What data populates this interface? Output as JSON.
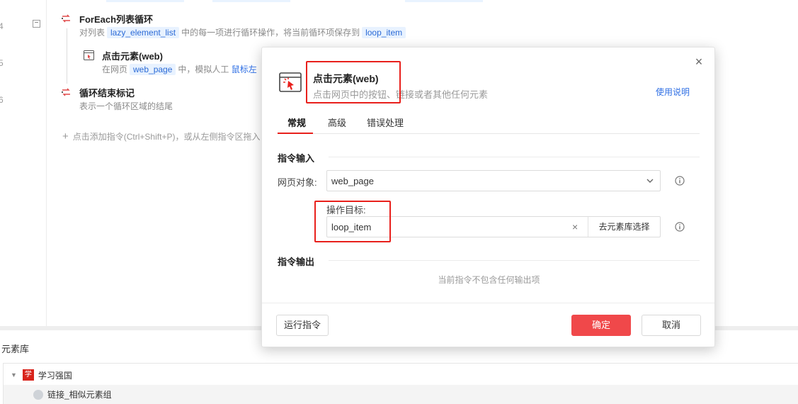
{
  "editor": {
    "line_numbers": [
      "4",
      "5",
      "6"
    ],
    "foreach": {
      "title": "ForEach列表循环",
      "desc_prefix": "对列表",
      "list_var": "lazy_element_list",
      "desc_mid": "中的每一项进行循环操作，将当前循环项保存到",
      "item_var": "loop_item"
    },
    "click_cmd": {
      "title": "点击元素(web)",
      "desc_prefix": "在网页",
      "page_var": "web_page",
      "desc_mid": "中，模拟人工",
      "link_text": "鼠标左"
    },
    "loop_end": {
      "title": "循环结束标记",
      "desc": "表示一个循环区域的结尾"
    },
    "add_hint": "点击添加指令(Ctrl+Shift+P)，或从左侧指令区拖入"
  },
  "library": {
    "title": "元素库",
    "root_item": "学习强国",
    "root_logo_text": "学",
    "child_item": "链接_相似元素组"
  },
  "modal": {
    "title": "点击元素(web)",
    "subtitle": "点击网页中的按钮、链接或者其他任何元素",
    "help_link": "使用说明",
    "tabs": [
      "常规",
      "高级",
      "错误处理"
    ],
    "input_section": "指令输入",
    "web_object_label": "网页对象:",
    "web_object_value": "web_page",
    "target_label": "操作目标:",
    "target_value": "loop_item",
    "pick_button": "去元素库选择",
    "output_section": "指令输出",
    "no_output": "当前指令不包含任何输出项",
    "run_button": "运行指令",
    "ok_button": "确定",
    "cancel_button": "取消"
  },
  "colors": {
    "accent_red": "#f0484a",
    "highlight_red": "#e8201c",
    "link_blue": "#2f6fe4",
    "tag_bg": "#e8f2ff"
  },
  "icons": {
    "loop": "loop-icon",
    "click": "click-element-icon",
    "close": "close-icon",
    "chevron": "chevron-down-icon",
    "info": "info-icon"
  }
}
